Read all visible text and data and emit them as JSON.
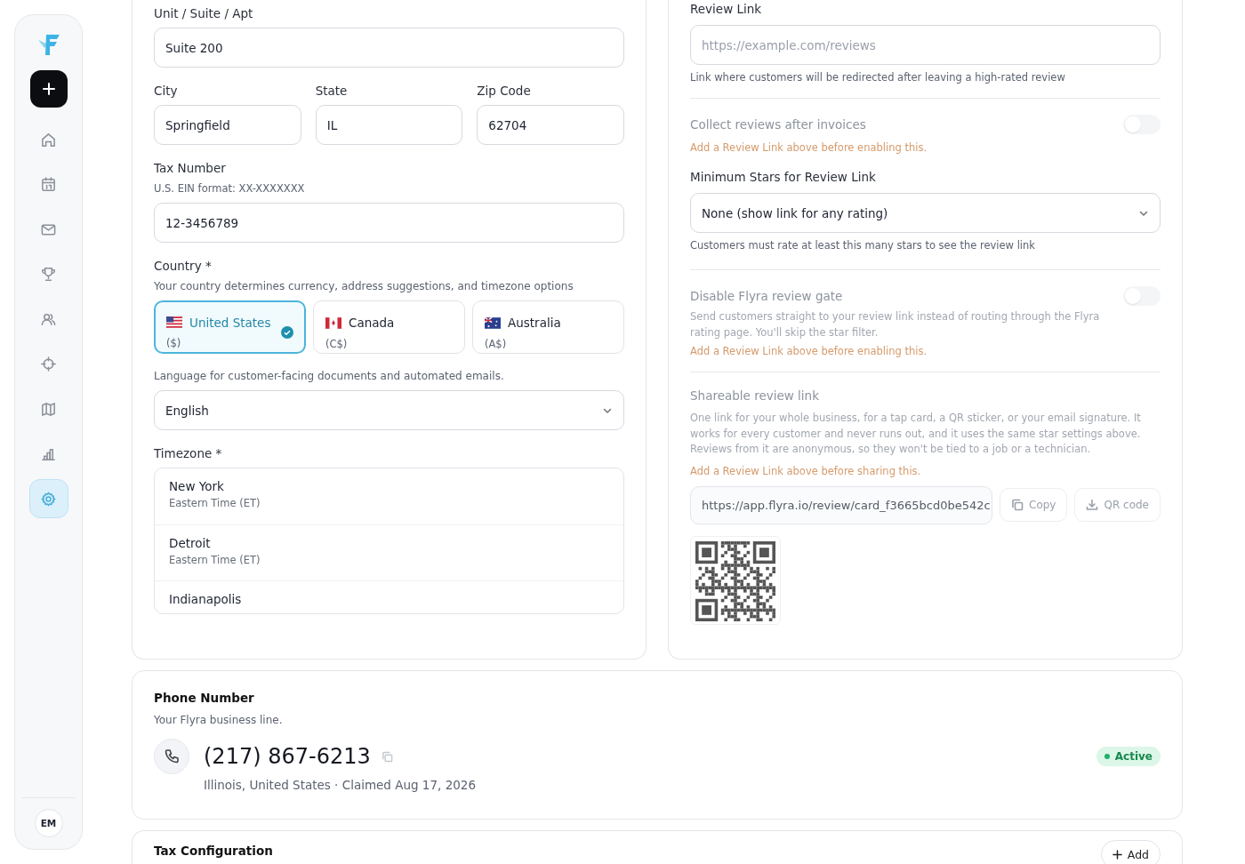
{
  "sidebar": {
    "items": [
      {
        "kind": "home",
        "selected": false
      },
      {
        "kind": "calendar",
        "selected": false
      },
      {
        "kind": "mail",
        "selected": false
      },
      {
        "kind": "trophy",
        "selected": false
      },
      {
        "kind": "users",
        "selected": false
      },
      {
        "kind": "target",
        "selected": false
      },
      {
        "kind": "map",
        "selected": false
      },
      {
        "kind": "chart",
        "selected": false
      },
      {
        "kind": "settings",
        "selected": true
      }
    ],
    "avatar": "EM"
  },
  "address": {
    "unit": {
      "label": "Unit / Suite / Apt",
      "value": "Suite 200"
    },
    "city_row": [
      {
        "label": "City",
        "value": "Springfield"
      },
      {
        "label": "State",
        "value": "IL"
      },
      {
        "label": "Zip Code",
        "value": "62704"
      }
    ],
    "tax_number": {
      "label": "Tax Number",
      "hint": "U.S. EIN format: XX-XXXXXXX",
      "value": "12-3456789"
    },
    "country": {
      "label": "Country *",
      "hint": "Your country determines currency, address suggestions, and timezone options",
      "options": [
        {
          "kind": "us",
          "name": "United States",
          "currency": "($)",
          "selected": true
        },
        {
          "kind": "ca",
          "name": "Canada",
          "currency": "(C$)",
          "selected": false
        },
        {
          "kind": "au",
          "name": "Australia",
          "currency": "(A$)",
          "selected": false
        }
      ]
    },
    "language": {
      "hint": "Language for customer-facing documents and automated emails.",
      "value": "English"
    },
    "timezone": {
      "label": "Timezone *",
      "options": [
        {
          "city": "New York",
          "zone": "Eastern Time (ET)"
        },
        {
          "city": "Detroit",
          "zone": "Eastern Time (ET)"
        },
        {
          "city": "Indianapolis"
        }
      ]
    }
  },
  "review": {
    "link": {
      "label": "Review Link",
      "placeholder": "https://example.com/reviews",
      "hint": "Link where customers will be redirected after leaving a high-rated review"
    },
    "collect": {
      "label": "Collect reviews after invoices",
      "warning": "Add a Review Link above before enabling this.",
      "on": false,
      "disabled": true
    },
    "min_stars": {
      "label": "Minimum Stars for Review Link",
      "value": "None (show link for any rating)",
      "hint": "Customers must rate at least this many stars to see the review link"
    },
    "gate": {
      "label": "Disable Flyra review gate",
      "description": "Send customers straight to your review link instead of routing through the Flyra rating page. You'll skip the star filter.",
      "warning": "Add a Review Link above before enabling this.",
      "on": false,
      "disabled": true
    },
    "shareable": {
      "label": "Shareable review link",
      "description": "One link for your whole business, for a tap card, a QR sticker, or your email signature. It works for every customer and never runs out, and it uses the same star settings above. Reviews from it are anonymous, so they won't be tied to a job or a technician.",
      "warning": "Add a Review Link above before sharing this.",
      "url": "https://app.flyra.io/review/card_f3665bcd0be542c",
      "copy": "Copy",
      "qr": "QR code"
    }
  },
  "phone": {
    "title": "Phone Number",
    "subtitle": "Your Flyra business line.",
    "number": "(217) 867-6213",
    "meta": "Illinois, United States · Claimed Aug 17, 2026",
    "status": "Active"
  },
  "tax": {
    "title": "Tax Configuration",
    "add": "Add"
  }
}
